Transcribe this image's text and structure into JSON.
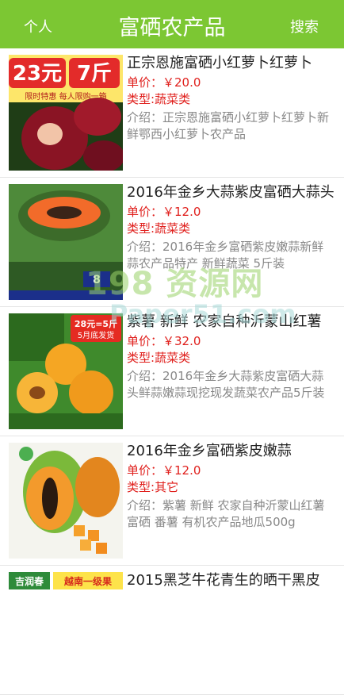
{
  "header": {
    "left_label": "个人",
    "title": "富硒农产品",
    "right_label": "搜索"
  },
  "items": [
    {
      "name": "正宗恩施富硒小红萝卜红萝卜",
      "price_label": "单价：",
      "price": "￥20.0",
      "category_label": "类型:",
      "category": "蔬菜类",
      "desc_label": "介绍：",
      "desc": "正宗恩施富硒小红萝卜红萝卜新鲜鄂西小红萝卜农产品",
      "image": {
        "badge_price": "23元",
        "badge_qty": "7斤",
        "badge_sub": "限时特惠 每人限购一箱"
      }
    },
    {
      "name": "2016年金乡大蒜紫皮富硒大蒜头",
      "price_label": "单价：",
      "price": "￥12.0",
      "category_label": "类型:",
      "category": "蔬菜类",
      "desc_label": "介绍：",
      "desc": "2016年金乡富硒紫皮嫩蒜新鲜蒜农产品特产 新鲜蔬菜 5斤装",
      "image": {
        "tag_right": "8"
      }
    },
    {
      "name": "紫薯 新鲜 农家自种沂蒙山红薯",
      "price_label": "单价：",
      "price": "￥32.0",
      "category_label": "类型:",
      "category": "蔬菜类",
      "desc_label": "介绍：",
      "desc": "2016年金乡大蒜紫皮富硒大蒜头鲜蒜嫩蒜现挖现发蔬菜农产品5斤装",
      "image": {
        "promo": "28元=5斤",
        "promo_sub": "5月底发货"
      }
    },
    {
      "name": "2016年金乡富硒紫皮嫩蒜",
      "price_label": "单价：",
      "price": "￥12.0",
      "category_label": "类型:",
      "category": "其它",
      "desc_label": "介绍：",
      "desc": "紫薯 新鲜 农家自种沂蒙山红薯 富硒 番薯 有机农产品地瓜500g",
      "image": {}
    },
    {
      "name": "2015黑芝牛花青生的晒干黑皮",
      "image": {
        "brand": "吉润春",
        "slogan": "越南一级果"
      }
    }
  ],
  "watermark": {
    "line1": "198 资源网",
    "line2": "Paper51.com"
  },
  "colors": {
    "header_bg": "#7cc733",
    "price_red": "#e0201d",
    "desc_gray": "#888888"
  }
}
